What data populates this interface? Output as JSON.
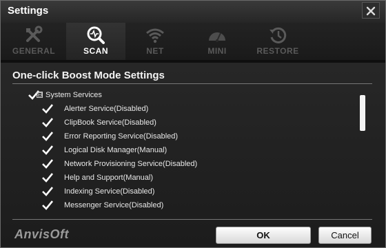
{
  "window": {
    "title": "Settings"
  },
  "tabs": [
    {
      "label": "GENERAL",
      "icon": "tools-icon",
      "active": false
    },
    {
      "label": "SCAN",
      "icon": "magnifier-pulse-icon",
      "active": true
    },
    {
      "label": "NET",
      "icon": "wifi-icon",
      "active": false
    },
    {
      "label": "MINI",
      "icon": "speedometer-icon",
      "active": false
    },
    {
      "label": "RESTORE",
      "icon": "restore-clock-icon",
      "active": false
    }
  ],
  "section": {
    "title": "One-click Boost Mode Settings"
  },
  "tree": {
    "group": {
      "label": "System Services",
      "checked": true,
      "expanded": true,
      "expander": "⊟"
    },
    "items": [
      {
        "label": "Alerter Service(Disabled)",
        "checked": true
      },
      {
        "label": "ClipBook Service(Disabled)",
        "checked": true
      },
      {
        "label": "Error Reporting Service(Disabled)",
        "checked": true
      },
      {
        "label": "Logical Disk Manager(Manual)",
        "checked": true
      },
      {
        "label": "Network Provisioning Service(Disabled)",
        "checked": true
      },
      {
        "label": "Help and Support(Manual)",
        "checked": true
      },
      {
        "label": "Indexing Service(Disabled)",
        "checked": true
      },
      {
        "label": "Messenger Service(Disabled)",
        "checked": true
      }
    ]
  },
  "footer": {
    "logo": "AnvisOft",
    "ok_label": "OK",
    "cancel_label": "Cancel"
  },
  "colors": {
    "background": "#1c1c1c",
    "active_tab_text": "#ffffff",
    "inactive_tab_text": "#5a5a5a"
  }
}
